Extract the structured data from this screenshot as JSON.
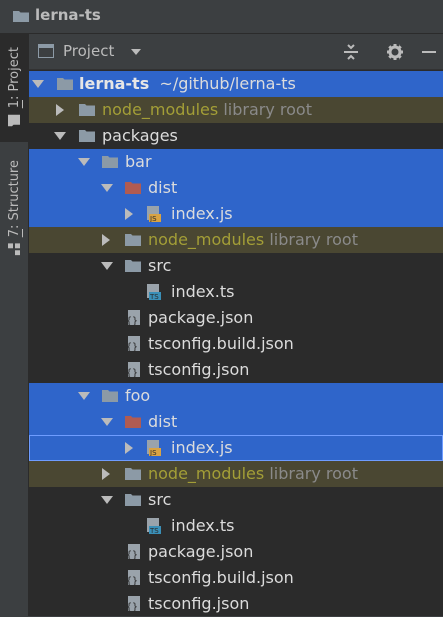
{
  "window": {
    "title": "lerna-ts"
  },
  "stripe": {
    "project_tab": {
      "number": "1",
      "label": ": Project"
    },
    "structure_tab": {
      "number": "7",
      "label": ": Structure"
    }
  },
  "panel": {
    "title": "Project"
  },
  "tree": {
    "root_name": "lerna-ts",
    "root_path": "~/github/lerna-ts",
    "library_root": "library root",
    "node_modules": "node_modules",
    "packages": "packages",
    "bar": "bar",
    "foo": "foo",
    "dist": "dist",
    "src": "src",
    "index_js": "index.js",
    "index_ts": "index.ts",
    "package_json": "package.json",
    "tsconfig_build_json": "tsconfig.build.json",
    "tsconfig_json": "tsconfig.json"
  },
  "colors": {
    "selection": "#2f65ca",
    "library_bg": "#4a4732",
    "library_text": "#a39e37",
    "dist_folder": "#b05b52",
    "folder": "#8c9aa6",
    "ts_badge": "#3a8fb7",
    "js_badge": "#d9a343"
  }
}
